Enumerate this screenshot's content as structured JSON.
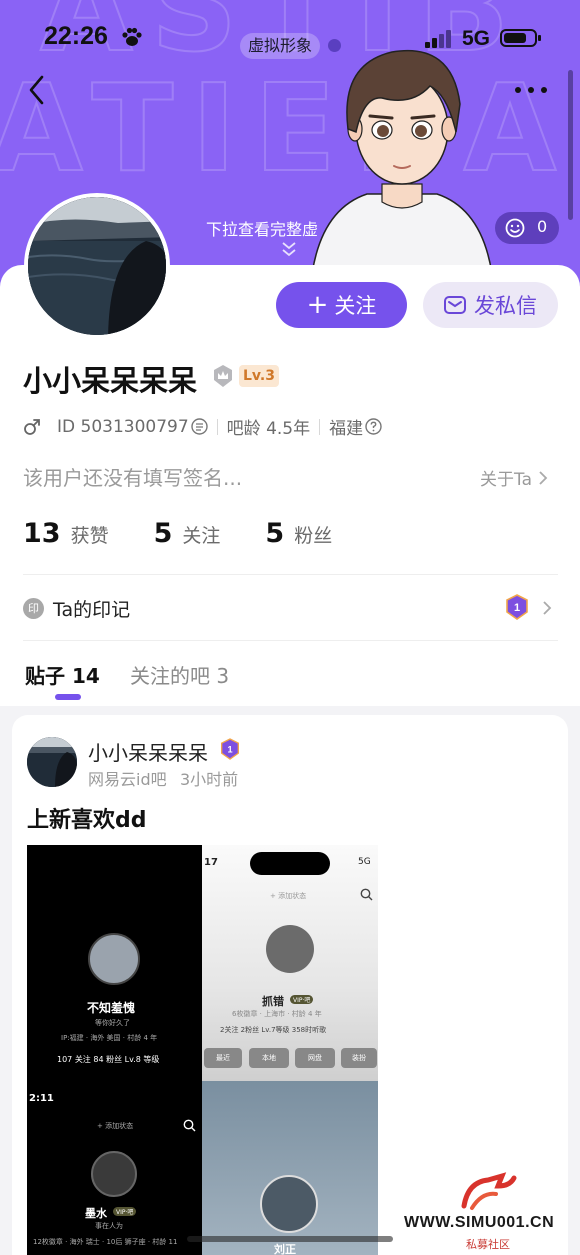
{
  "status_bar": {
    "time": "22:26",
    "network": "5G"
  },
  "header": {
    "virtual_pill": "虚拟形象",
    "pull_hint": "下拉查看完整虚",
    "like_count": "0",
    "background_color": "#8a63f5"
  },
  "profile": {
    "follow_label": "关注",
    "follow_plus": "+",
    "message_label": "发私信",
    "username": "小小呆呆呆呆",
    "level": "Lv.3",
    "id_text": "ID 5031300797",
    "tieba_age": "吧龄 4.5年",
    "location": "福建",
    "bio": "该用户还没有填写签名...",
    "about_link": "关于Ta",
    "stats": [
      {
        "num": "13",
        "label": "获赞"
      },
      {
        "num": "5",
        "label": "关注"
      },
      {
        "num": "5",
        "label": "粉丝"
      }
    ],
    "mark_icon_text": "印",
    "mark_label": "Ta的印记"
  },
  "tabs": {
    "posts": "贴子 14",
    "bars": "关注的吧 3",
    "accent_color": "#7652ec"
  },
  "post": {
    "author": "小小呆呆呆呆",
    "bar": "网易云id吧",
    "time": "3小时前",
    "title": "上新喜欢dd",
    "image": {
      "q1": {
        "name": "不知羞愧",
        "sub": "等你好久了",
        "ip": "IP:福建 · 海外 美国 · 村龄 4 年",
        "stats": "107 关注   84 粉丝   Lv.8 等级"
      },
      "q2": {
        "time": "17",
        "net": "5G",
        "add_status": "+ 添加状态",
        "name": "抓错",
        "vip": "VIP·吧",
        "line": "6枚徽章 · 上海市 · 村龄 4 年",
        "stats": "2关注  2粉丝  Lv.7等级  358时听歌",
        "btn1": "最近",
        "btn2": "本地",
        "btn3": "网盘",
        "btn4": "装扮"
      },
      "q3": {
        "time": "2:11",
        "add_status": "+ 添加状态",
        "name": "墨水",
        "vip": "VIP·吧",
        "sub": "事在人为",
        "line": "12枚徽章 · 海外 瑞士 · 10后 狮子座 · 村龄 11"
      },
      "q4": {
        "name": "刘正"
      }
    }
  },
  "watermark": {
    "text": "WWW.SIMU001.CN",
    "sub": "私募社区"
  }
}
